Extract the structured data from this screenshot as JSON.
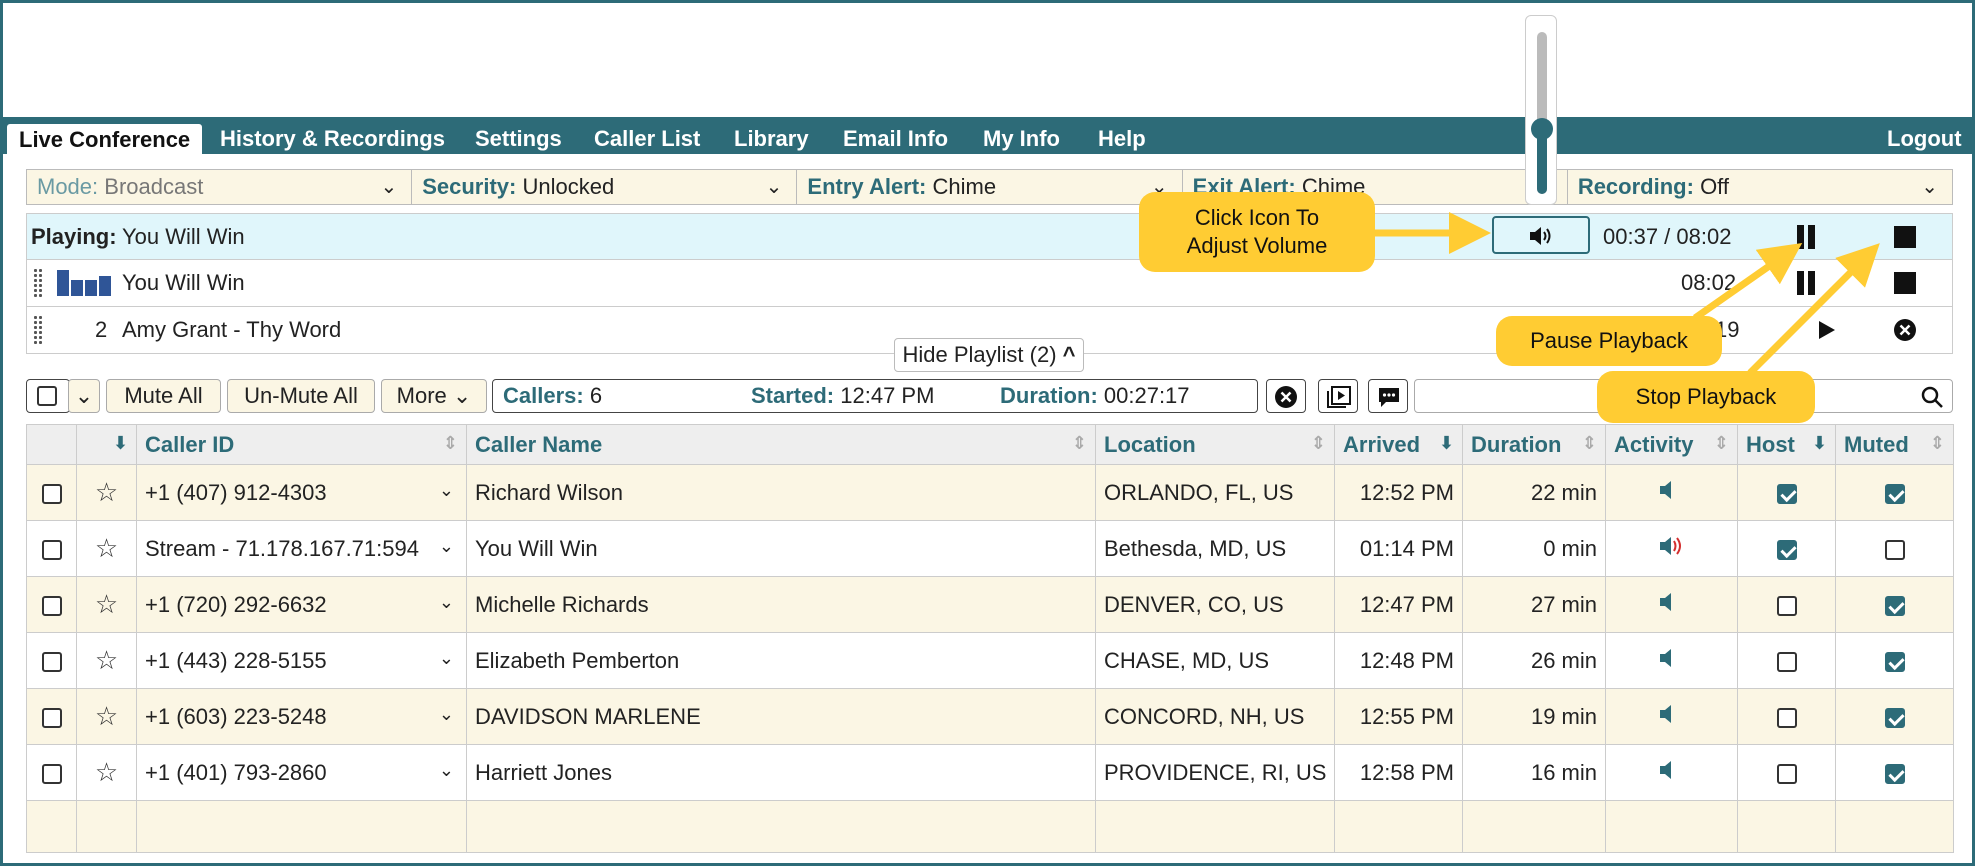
{
  "nav": {
    "tabs": [
      "Live Conference",
      "History & Recordings",
      "Settings",
      "Caller List",
      "Library",
      "Email Info",
      "My Info",
      "Help"
    ],
    "logout": "Logout"
  },
  "modebar": [
    {
      "label": "Mode:",
      "value": "Broadcast"
    },
    {
      "label": "Security:",
      "value": "Unlocked"
    },
    {
      "label": "Entry Alert:",
      "value": "Chime"
    },
    {
      "label": "Exit Alert:",
      "value": "Chime"
    },
    {
      "label": "Recording:",
      "value": "Off"
    }
  ],
  "playing": {
    "label": "Playing:",
    "title": "You Will Win",
    "time": "00:37 / 08:02"
  },
  "playlist": [
    {
      "index": "",
      "title": "You Will Win",
      "duration": "08:02"
    },
    {
      "index": "2",
      "title": "Amy Grant - Thy Word",
      "duration": "19"
    }
  ],
  "volume_level": 0.4,
  "hide_playlist": "Hide Playlist (2)",
  "toolbar": {
    "mute_all": "Mute All",
    "unmute_all": "Un-Mute All",
    "more": "More",
    "callers_label": "Callers:",
    "callers_value": "6",
    "started_label": "Started:",
    "started_value": "12:47 PM",
    "duration_label": "Duration:",
    "duration_value": "00:27:17"
  },
  "table": {
    "headers": [
      "Caller ID",
      "Caller Name",
      "Location",
      "Arrived",
      "Duration",
      "Activity",
      "Host",
      "Muted"
    ],
    "rows": [
      {
        "caller_id": "+1 (407) 912-4303",
        "name": "Richard Wilson",
        "location": "ORLANDO, FL, US",
        "arrived": "12:52 PM",
        "duration": "22 min",
        "speaking": false,
        "host": true,
        "muted": true
      },
      {
        "caller_id": "Stream - 71.178.167.71:594",
        "name": "You Will Win",
        "location": "Bethesda, MD, US",
        "arrived": "01:14 PM",
        "duration": "0 min",
        "speaking": true,
        "host": true,
        "muted": false
      },
      {
        "caller_id": "+1 (720) 292-6632",
        "name": "Michelle Richards",
        "location": "DENVER, CO, US",
        "arrived": "12:47 PM",
        "duration": "27 min",
        "speaking": false,
        "host": false,
        "muted": true
      },
      {
        "caller_id": "+1 (443) 228-5155",
        "name": "Elizabeth Pemberton",
        "location": "CHASE, MD, US",
        "arrived": "12:48 PM",
        "duration": "26 min",
        "speaking": false,
        "host": false,
        "muted": true
      },
      {
        "caller_id": "+1 (603) 223-5248",
        "name": "DAVIDSON MARLENE",
        "location": "CONCORD, NH, US",
        "arrived": "12:55 PM",
        "duration": "19 min",
        "speaking": false,
        "host": false,
        "muted": true
      },
      {
        "caller_id": "+1 (401) 793-2860",
        "name": "Harriett Jones",
        "location": "PROVIDENCE, RI, US",
        "arrived": "12:58 PM",
        "duration": "16 min",
        "speaking": false,
        "host": false,
        "muted": true
      }
    ]
  },
  "callouts": {
    "volume": "Click Icon To Adjust Volume",
    "pause": "Pause Playback",
    "stop": "Stop Playback"
  },
  "colors": {
    "accent": "#2d6b78",
    "callout": "#ffcc33",
    "row_alt": "#fbf6e4",
    "playing_bg": "#e0f6fb"
  }
}
